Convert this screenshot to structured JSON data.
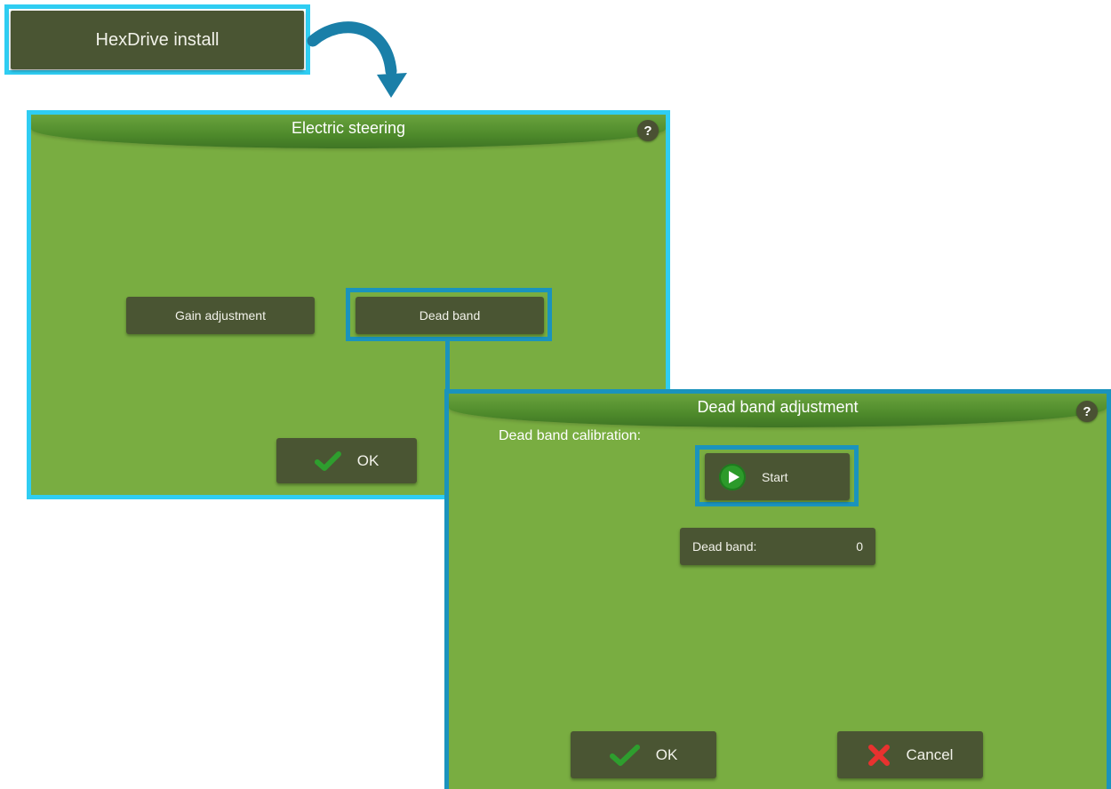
{
  "install": {
    "label": "HexDrive install"
  },
  "steering_dialog": {
    "title": "Electric steering",
    "help": "?",
    "buttons": {
      "gain": "Gain adjustment",
      "dead_band": "Dead band",
      "ok": "OK"
    }
  },
  "deadband_dialog": {
    "title": "Dead band adjustment",
    "help": "?",
    "calibration_label": "Dead band calibration:",
    "start_label": "Start",
    "dead_band_label": "Dead band:",
    "dead_band_value": "0",
    "ok": "OK",
    "cancel": "Cancel"
  },
  "colors": {
    "dialog_bg": "#79ad41",
    "button_bg": "#4a5533",
    "highlight_light": "#2fcdf2",
    "highlight_dark": "#1a93bd",
    "arrow": "#1a7fa8"
  },
  "icons": [
    "help-icon",
    "play-icon",
    "check-icon",
    "close-icon",
    "curved-arrow-icon"
  ]
}
